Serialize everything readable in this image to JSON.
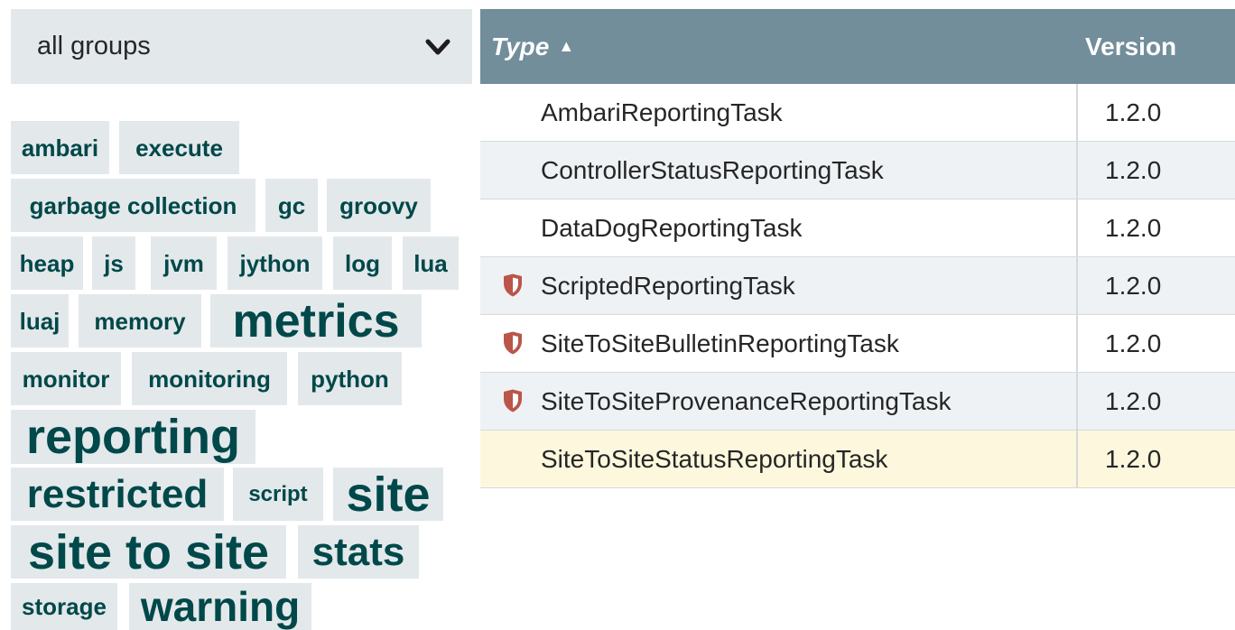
{
  "filter": {
    "selected": "all groups",
    "icon": "chevron-down-icon"
  },
  "tags": [
    {
      "label": "ambari"
    },
    {
      "label": "execute"
    },
    {
      "label": "garbage collection"
    },
    {
      "label": "gc"
    },
    {
      "label": "groovy"
    },
    {
      "label": "heap"
    },
    {
      "label": "js"
    },
    {
      "label": "jvm"
    },
    {
      "label": "jython"
    },
    {
      "label": "log"
    },
    {
      "label": "lua"
    },
    {
      "label": "luaj"
    },
    {
      "label": "memory"
    },
    {
      "label": "metrics"
    },
    {
      "label": "monitor"
    },
    {
      "label": "monitoring"
    },
    {
      "label": "python"
    },
    {
      "label": "reporting"
    },
    {
      "label": "restricted"
    },
    {
      "label": "script"
    },
    {
      "label": "site"
    },
    {
      "label": "site to site"
    },
    {
      "label": "stats"
    },
    {
      "label": "storage"
    },
    {
      "label": "warning"
    }
  ],
  "table": {
    "columns": {
      "type": "Type",
      "type_sort_icon": "sort-ascending-icon",
      "version": "Version"
    },
    "rows": [
      {
        "type": "AmbariReportingTask",
        "version": "1.2.0",
        "restricted": false
      },
      {
        "type": "ControllerStatusReportingTask",
        "version": "1.2.0",
        "restricted": false
      },
      {
        "type": "DataDogReportingTask",
        "version": "1.2.0",
        "restricted": false
      },
      {
        "type": "ScriptedReportingTask",
        "version": "1.2.0",
        "restricted": true
      },
      {
        "type": "SiteToSiteBulletinReportingTask",
        "version": "1.2.0",
        "restricted": true
      },
      {
        "type": "SiteToSiteProvenanceReportingTask",
        "version": "1.2.0",
        "restricted": true
      },
      {
        "type": "SiteToSiteStatusReportingTask",
        "version": "1.2.0",
        "restricted": false
      }
    ],
    "selected_row": 6
  },
  "colors": {
    "header": "#728e9b",
    "tag_bg": "#e3e8eb",
    "tag_text": "#004849",
    "restricted_icon": "#ba554a",
    "selected_row": "#fdf8dd"
  }
}
